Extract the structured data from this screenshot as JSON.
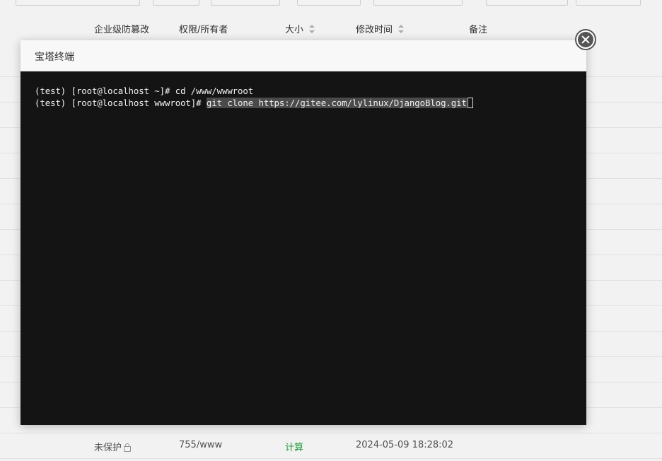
{
  "columns": [
    "企业级防篡改",
    "权限/所有者",
    "大小",
    "修改时间",
    "备注"
  ],
  "last_row": {
    "protection": "未保护",
    "permission": "755/www",
    "size": "计算",
    "modified": "2024-05-09 18:28:02"
  },
  "modal": {
    "title": "宝塔终端"
  },
  "terminal": {
    "lines": [
      {
        "prompt": "(test) [root@localhost ~]# ",
        "command": "cd /www/wwwroot"
      },
      {
        "prompt": "(test) [root@localhost wwwroot]# ",
        "command": "git clone https://gitee.com/lylinux/DjangoBlog.git"
      }
    ]
  },
  "colors": {
    "terminal_bg": "#141414",
    "success_green": "#20a53a"
  }
}
